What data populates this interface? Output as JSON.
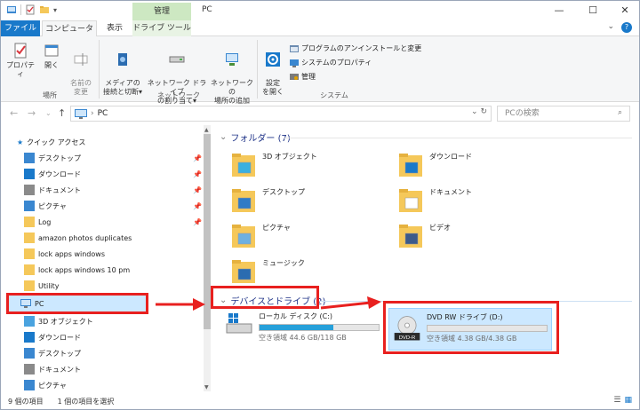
{
  "window": {
    "title": "PC",
    "manage_tab": "管理"
  },
  "tabs": {
    "file": "ファイル",
    "computer": "コンピューター",
    "view": "表示",
    "drive_tools": "ドライブ ツール"
  },
  "ribbon": {
    "location": {
      "properties": "プロパティ",
      "open": "開く",
      "rename": "名前の\n変更",
      "label": "場所"
    },
    "network": {
      "media": "メディアの\n接続と切断▾",
      "map_drive": "ネットワーク ドライブ\nの割り当て▾",
      "add_location": "ネットワークの\n場所の追加",
      "label": "ネットワーク"
    },
    "system": {
      "settings": "設定\nを開く",
      "uninstall": "プログラムのアンインストールと変更",
      "sys_props": "システムのプロパティ",
      "manage": "管理",
      "label": "システム"
    }
  },
  "address": {
    "path": "PC",
    "search_placeholder": "PCの検索"
  },
  "nav": {
    "quick_access": "クイック アクセス",
    "items": [
      {
        "label": "デスクトップ",
        "pinned": true
      },
      {
        "label": "ダウンロード",
        "pinned": true
      },
      {
        "label": "ドキュメント",
        "pinned": true
      },
      {
        "label": "ピクチャ",
        "pinned": true
      },
      {
        "label": "Log",
        "pinned": true
      },
      {
        "label": "amazon photos duplicates",
        "pinned": false
      },
      {
        "label": "lock apps windows",
        "pinned": false
      },
      {
        "label": "lock apps windows 10 pm",
        "pinned": false
      },
      {
        "label": "Utility",
        "pinned": false
      }
    ],
    "pc": "PC",
    "pc_items": [
      "3D オブジェクト",
      "ダウンロード",
      "デスクトップ",
      "ドキュメント",
      "ピクチャ"
    ]
  },
  "content": {
    "folders_header": "フォルダー (7)",
    "folders": [
      "3D オブジェクト",
      "ダウンロード",
      "デスクトップ",
      "ドキュメント",
      "ピクチャ",
      "ビデオ",
      "ミュージック"
    ],
    "devices_header": "デバイスとドライブ (2)",
    "drives": [
      {
        "name": "ローカル ディスク (C:)",
        "free_text": "空き領域 44.6 GB/118 GB",
        "used_fraction": 0.62
      },
      {
        "name": "DVD RW ドライブ (D:)",
        "free_text": "空き領域 4.38 GB/4.38 GB",
        "used_fraction": 0.0,
        "disc_label": "DVD-R"
      }
    ]
  },
  "status": {
    "count": "9 個の項目",
    "selected": "1 個の項目を選択"
  },
  "colors": {
    "accent": "#1979ca",
    "highlight": "#e8201f",
    "folder": "#f5c85a"
  }
}
